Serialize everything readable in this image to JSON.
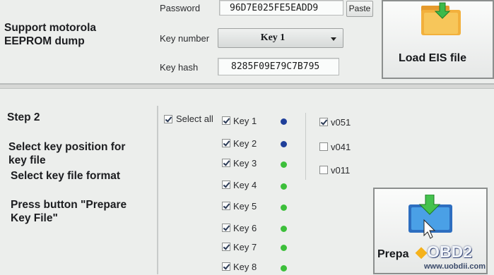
{
  "eeprom": {
    "instruction": "Support motorola\nEEPROM dump",
    "password_label": "Password",
    "password_value": "96D7E025FE5EADD9",
    "paste_label": "Paste",
    "key_number_label": "Key number",
    "key_number_value": "Key 1",
    "key_hash_label": "Key hash",
    "key_hash_value": "8285F09E79C7B795",
    "load_eis_label": "Load EIS file"
  },
  "step2": {
    "title": "Step 2",
    "select_position": "Select key position for\nkey file",
    "select_format": "Select key file format",
    "press_button": "Press button \"Prepare\nKey File\"",
    "select_all_label": "Select all",
    "select_all_checked": true,
    "keys": [
      {
        "label": "Key 1",
        "checked": true,
        "status": "blue"
      },
      {
        "label": "Key 2",
        "checked": true,
        "status": "blue"
      },
      {
        "label": "Key 3",
        "checked": true,
        "status": "green"
      },
      {
        "label": "Key 4",
        "checked": true,
        "status": "green"
      },
      {
        "label": "Key 5",
        "checked": true,
        "status": "green"
      },
      {
        "label": "Key 6",
        "checked": true,
        "status": "green"
      },
      {
        "label": "Key 7",
        "checked": true,
        "status": "green"
      },
      {
        "label": "Key 8",
        "checked": true,
        "status": "green"
      }
    ],
    "formats": [
      {
        "label": "v051",
        "checked": true
      },
      {
        "label": "v041",
        "checked": false
      },
      {
        "label": "v011",
        "checked": false
      }
    ],
    "prepare_label": "Prepa"
  },
  "colors": {
    "status_blue": "#1f3f9a",
    "status_green": "#3cbf3a"
  },
  "watermark": {
    "brand": "OBD2",
    "url": "www.uobdii.com"
  }
}
